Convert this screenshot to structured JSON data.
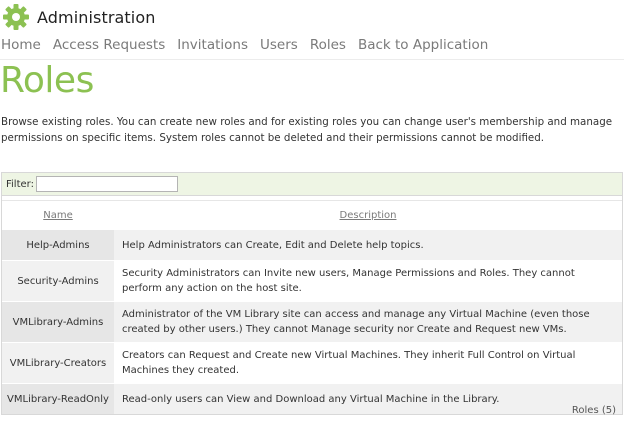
{
  "app": {
    "title": "Administration",
    "logo_icon": "gear-icon",
    "accent": "#8cc152"
  },
  "nav": {
    "items": [
      {
        "label": "Home"
      },
      {
        "label": "Access Requests"
      },
      {
        "label": "Invitations"
      },
      {
        "label": "Users"
      },
      {
        "label": "Roles"
      },
      {
        "label": "Back to Application"
      }
    ]
  },
  "page": {
    "title": "Roles",
    "description": "Browse existing roles. You can create new roles and for existing roles you can change user's membership and manage permissions on specific items. System roles cannot be deleted and their permissions cannot be modified."
  },
  "grid": {
    "filter_label": "Filter:",
    "filter_value": "",
    "columns": {
      "name": "Name",
      "description": "Description"
    },
    "rows": [
      {
        "name": "Help-Admins",
        "description": "Help Administrators can Create, Edit and Delete help topics."
      },
      {
        "name": "Security-Admins",
        "description": "Security Administrators can Invite new users, Manage Permissions and Roles. They cannot perform any action on the host site."
      },
      {
        "name": "VMLibrary-Admins",
        "description": "Administrator of the VM Library site can access and manage any Virtual Machine (even those created by other users.) They cannot Manage security nor Create and Request new VMs."
      },
      {
        "name": "VMLibrary-Creators",
        "description": "Creators can Request and Create new Virtual Machines. They inherit Full Control on Virtual Machines they created."
      },
      {
        "name": "VMLibrary-ReadOnly",
        "description": "Read-only users can View and Download any Virtual Machine in the Library."
      }
    ],
    "count_label": "Roles (5)"
  }
}
